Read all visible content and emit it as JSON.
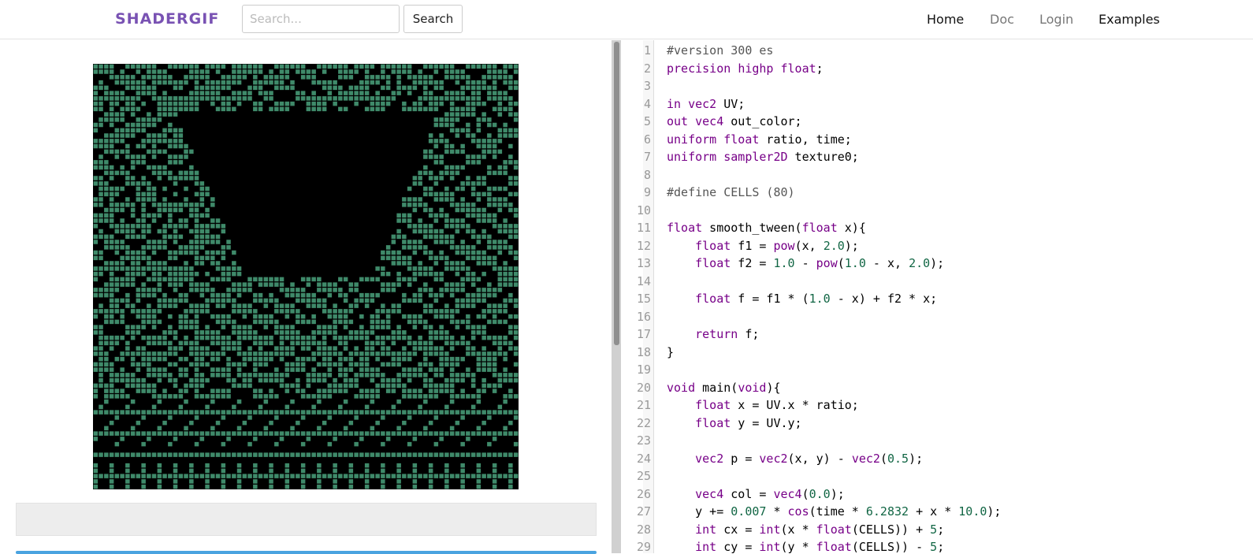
{
  "navbar": {
    "brand": "SHADERGIF",
    "search_placeholder": "Search...",
    "search_button": "Search",
    "links": [
      "Home",
      "Doc",
      "Login",
      "Examples"
    ]
  },
  "preview": {
    "cell_color": "#3f8a6a",
    "background": "#000000"
  },
  "colors": {
    "brand": "#7952b3",
    "keyword": "#770088",
    "number": "#116644",
    "blue_bar": "#4aa3e0"
  },
  "editor": {
    "lines": [
      {
        "n": "1",
        "text": "#version 300 es"
      },
      {
        "n": "2",
        "text": "precision highp float;"
      },
      {
        "n": "3",
        "text": ""
      },
      {
        "n": "4",
        "text": "in vec2 UV;"
      },
      {
        "n": "5",
        "text": "out vec4 out_color;"
      },
      {
        "n": "6",
        "text": "uniform float ratio, time;"
      },
      {
        "n": "7",
        "text": "uniform sampler2D texture0;"
      },
      {
        "n": "8",
        "text": ""
      },
      {
        "n": "9",
        "text": "#define CELLS (80)"
      },
      {
        "n": "10",
        "text": ""
      },
      {
        "n": "11",
        "text": "float smooth_tween(float x){"
      },
      {
        "n": "12",
        "text": "    float f1 = pow(x, 2.0);"
      },
      {
        "n": "13",
        "text": "    float f2 = 1.0 - pow(1.0 - x, 2.0);"
      },
      {
        "n": "14",
        "text": ""
      },
      {
        "n": "15",
        "text": "    float f = f1 * (1.0 - x) + f2 * x;"
      },
      {
        "n": "16",
        "text": ""
      },
      {
        "n": "17",
        "text": "    return f;"
      },
      {
        "n": "18",
        "text": "}"
      },
      {
        "n": "19",
        "text": ""
      },
      {
        "n": "20",
        "text": "void main(void){"
      },
      {
        "n": "21",
        "text": "    float x = UV.x * ratio;"
      },
      {
        "n": "22",
        "text": "    float y = UV.y;"
      },
      {
        "n": "23",
        "text": ""
      },
      {
        "n": "24",
        "text": "    vec2 p = vec2(x, y) - vec2(0.5);"
      },
      {
        "n": "25",
        "text": ""
      },
      {
        "n": "26",
        "text": "    vec4 col = vec4(0.0);"
      },
      {
        "n": "27",
        "text": "    y += 0.007 * cos(time * 6.2832 + x * 10.0);"
      },
      {
        "n": "28",
        "text": "    int cx = int(x * float(CELLS)) + 5;"
      },
      {
        "n": "29",
        "text": "    int cy = int(y * float(CELLS)) - 5;"
      }
    ]
  }
}
